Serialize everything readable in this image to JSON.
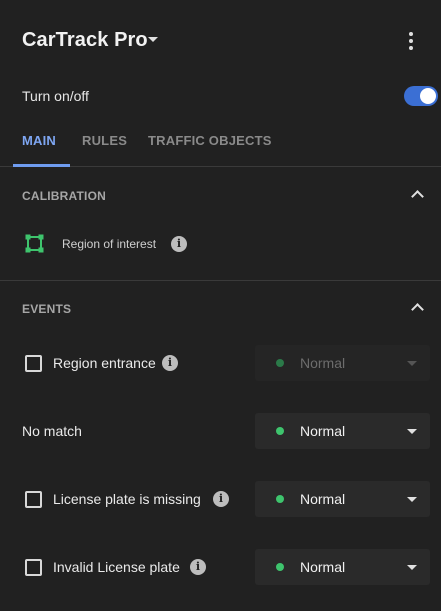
{
  "header": {
    "title": "CarTrack Pro"
  },
  "power": {
    "label": "Turn on/off",
    "state": "on"
  },
  "tabs": {
    "main": "MAIN",
    "rules": "RULES",
    "traffic": "TRAFFIC OBJECTS",
    "active": "MAIN"
  },
  "calibration": {
    "title": "CALIBRATION",
    "roi_label": "Region of interest"
  },
  "events": {
    "title": "EVENTS",
    "items": [
      {
        "label": "Region entrance",
        "has_checkbox": true,
        "checked": false,
        "has_info": true,
        "level": "Normal",
        "enabled": false
      },
      {
        "label": "No match",
        "has_checkbox": false,
        "has_info": false,
        "level": "Normal",
        "enabled": true
      },
      {
        "label": "License plate is missing",
        "has_checkbox": true,
        "checked": false,
        "has_info": true,
        "level": "Normal",
        "enabled": true
      },
      {
        "label": "Invalid License plate",
        "has_checkbox": true,
        "checked": false,
        "has_info": true,
        "level": "Normal",
        "enabled": true
      }
    ]
  },
  "colors": {
    "accent": "#3b6fd4",
    "tab_active": "#7ea6f2",
    "status_normal": "#3ec46d",
    "roi_green": "#3ec46d",
    "background": "#212121"
  }
}
